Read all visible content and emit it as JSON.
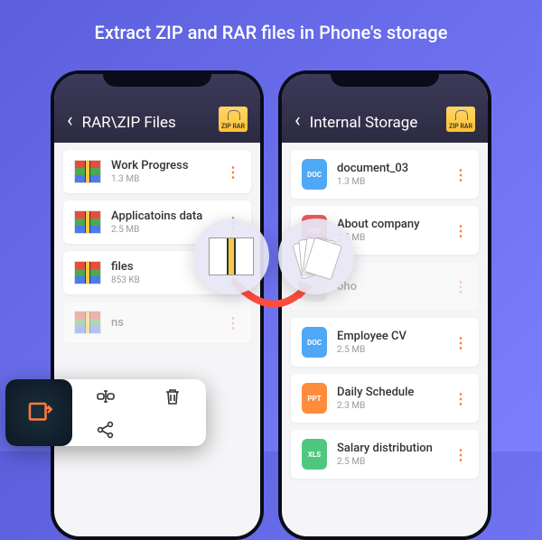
{
  "headline": "Extract ZIP and RAR files in Phone's storage",
  "badge_text": "ZIP RAR",
  "left_phone": {
    "title": "RAR\\ZIP Files",
    "files": [
      {
        "name": "Work Progress",
        "size": "1.3 MB"
      },
      {
        "name": "Applicatoins data",
        "size": "2.5 MB"
      },
      {
        "name": "files",
        "size": "853 KB"
      }
    ]
  },
  "right_phone": {
    "title": "Internal Storage",
    "files": [
      {
        "type": "DOC",
        "name": "document_03",
        "size": "1.3 MB"
      },
      {
        "type": "PDF",
        "name": "About company",
        "size": "2.5 MB"
      },
      {
        "type": "DOC",
        "name": "Employee CV",
        "size": "2.5 MB"
      },
      {
        "type": "PPT",
        "name": "Daily Schedule",
        "size": "2.3 MB"
      },
      {
        "type": "XLS",
        "name": "Salary distribution",
        "size": "2.5 MB"
      }
    ],
    "ghost": {
      "type": "",
      "name": "oho",
      "size": ""
    }
  },
  "menu": {
    "extract": "extract-icon",
    "rename": "rename-icon",
    "share": "share-icon",
    "delete": "delete-icon"
  }
}
